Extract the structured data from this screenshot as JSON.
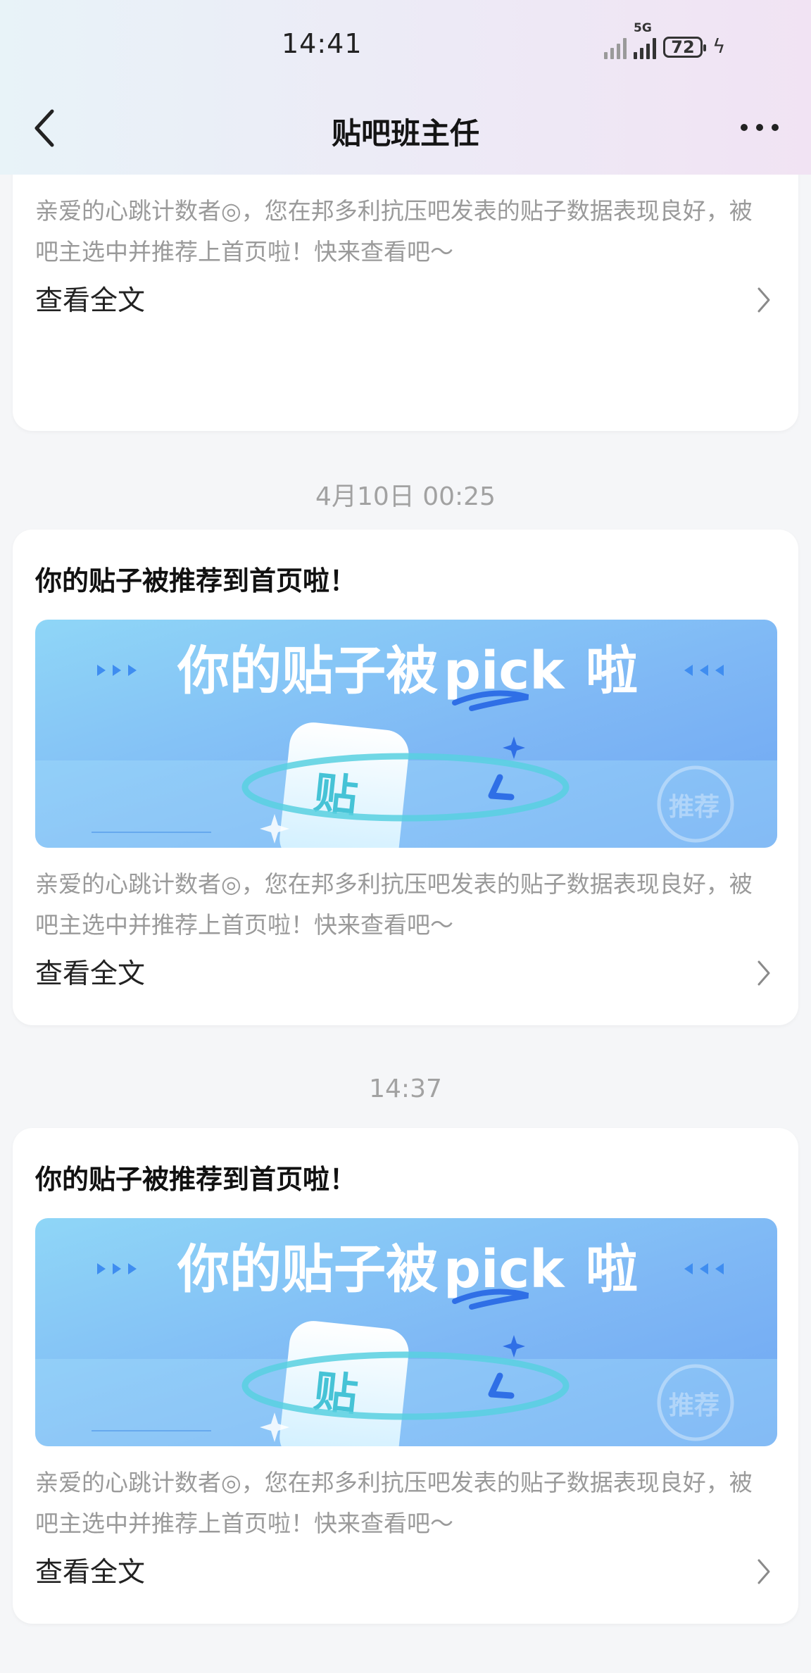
{
  "status_bar": {
    "time": "14:41",
    "network": "5G",
    "battery": "72"
  },
  "nav": {
    "title": "贴吧班主任"
  },
  "banner": {
    "headline_a": "你的贴子被",
    "headline_pick": "pick",
    "headline_b": "啦",
    "tile_char": "贴",
    "stamp": "推荐"
  },
  "messages": [
    {
      "time": "",
      "title": "",
      "desc": "亲爱的心跳计数者◎，您在邦多利抗压吧发表的贴子数据表现良好，被吧主选中并推荐上首页啦！快来查看吧～",
      "read_more": "查看全文"
    },
    {
      "time": "4月10日 00:25",
      "title": "你的贴子被推荐到首页啦！",
      "desc": "亲爱的心跳计数者◎，您在邦多利抗压吧发表的贴子数据表现良好，被吧主选中并推荐上首页啦！快来查看吧～",
      "read_more": "查看全文"
    },
    {
      "time": "14:37",
      "title": "你的贴子被推荐到首页啦！",
      "desc": "亲爱的心跳计数者◎，您在邦多利抗压吧发表的贴子数据表现良好，被吧主选中并推荐上首页啦！快来查看吧～",
      "read_more": "查看全文"
    }
  ]
}
